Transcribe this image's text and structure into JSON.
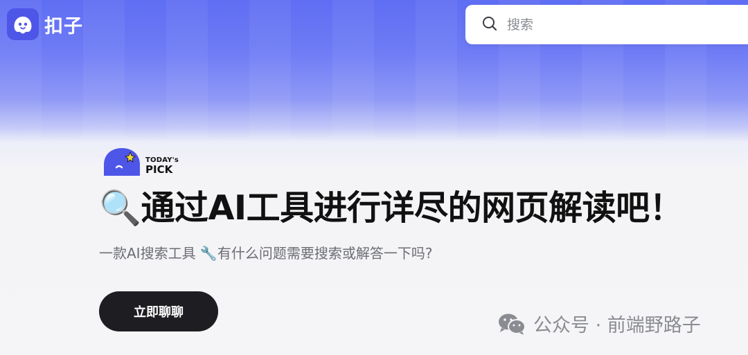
{
  "brand": {
    "name": "扣子"
  },
  "search": {
    "placeholder": "搜索"
  },
  "badge": {
    "line1": "TODAY's",
    "line2": "PICK"
  },
  "hero": {
    "headline": "🔍通过AI工具进行详尽的网页解读吧！",
    "subtitle": "一款AI搜索工具 🔧有什么问题需要搜索或解答一下吗?",
    "cta_label": "立即聊聊"
  },
  "watermark": {
    "text": "公众号 · 前端野路子"
  },
  "colors": {
    "brand_purple": "#4e56e8",
    "cta_background": "#1e1e22",
    "page_background": "#f5f5f7",
    "header_gradient_top": "#5f6ef3"
  }
}
